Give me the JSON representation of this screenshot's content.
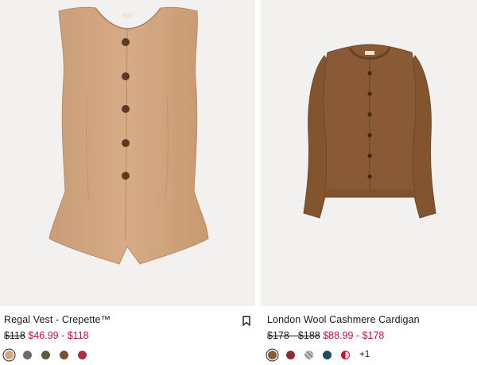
{
  "products": [
    {
      "name": "Regal Vest - Crepette™",
      "original_price": "$118",
      "sale_price": "$46.99 - $118",
      "colors": [
        "#d4a883",
        "#6b6b6b",
        "#5c5a3a",
        "#7a5033",
        "#a8303f"
      ],
      "selected_color": 0,
      "more_colors": "",
      "bookmark_icon": "bookmark-icon"
    },
    {
      "name": "London Wool Cashmere Cardigan",
      "original_price": "$178 - $188",
      "sale_price": "$88.99 - $178",
      "colors": [
        "#8a5a36",
        "#8e2a3c",
        "#9a9a9a",
        "#1f4a5a",
        "#c8102e"
      ],
      "selected_color": 0,
      "more_colors": "+1"
    }
  ],
  "colors": {
    "sale": "#c8102e",
    "image_bg": "#f2f1ef",
    "vest": "#d3a884",
    "cardigan": "#8a5a36"
  }
}
